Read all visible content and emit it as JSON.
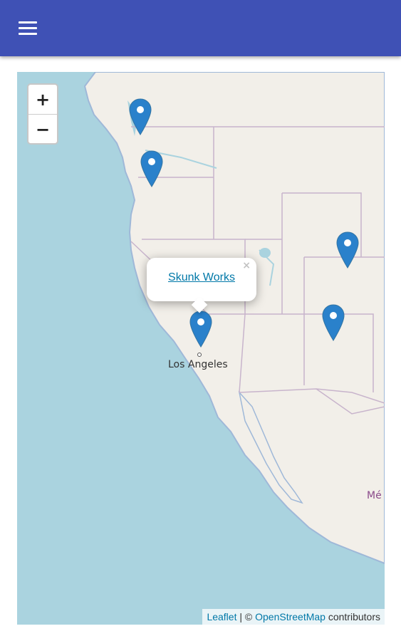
{
  "app_bar": {
    "menu_icon": "hamburger-menu-icon",
    "color": "#3f51b5"
  },
  "map": {
    "zoom_in_label": "+",
    "zoom_out_label": "−",
    "water_color": "#aad3df",
    "land_color": "#f2efe9",
    "marker_color": "#2a81cb",
    "city_labels": {
      "los_angeles": "Los Angeles",
      "mexico_partial": "Mé"
    },
    "markers": [
      {
        "region": "washington-north"
      },
      {
        "region": "washington-south"
      },
      {
        "region": "los-angeles-north"
      },
      {
        "region": "colorado"
      },
      {
        "region": "new-mexico"
      }
    ],
    "popup": {
      "link_text": "Skunk Works",
      "close_label": "×"
    },
    "attribution": {
      "leaflet": "Leaflet",
      "separator": " | © ",
      "osm": "OpenStreetMap",
      "contributors": " contributors"
    }
  }
}
